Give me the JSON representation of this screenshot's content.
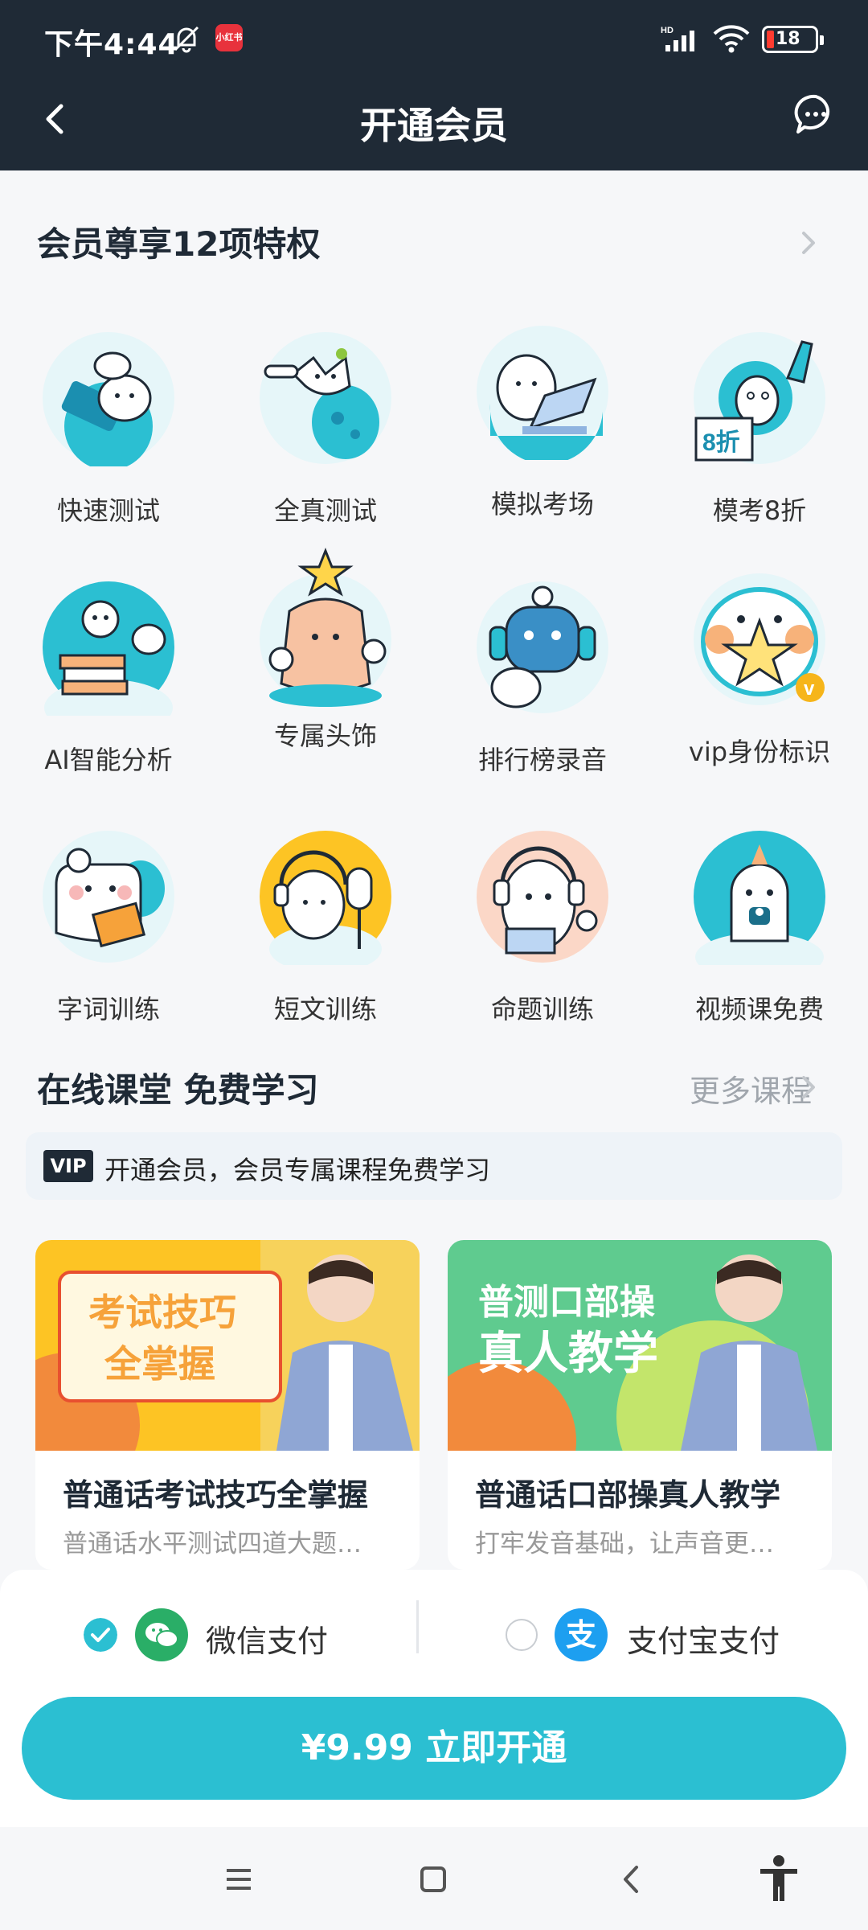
{
  "status_bar": {
    "time": "下午4:44",
    "app_badge": "小红书",
    "battery": "18",
    "icons": [
      "mute-icon",
      "hd-signal-icon",
      "wifi-icon",
      "battery-icon"
    ]
  },
  "header": {
    "title": "开通会员",
    "back_icon": "chevron-left-icon",
    "message_icon": "chat-bubble-icon"
  },
  "privileges": {
    "title": "会员尊享12项特权",
    "items": [
      {
        "label": "快速测试",
        "icon": "quick-test-icon"
      },
      {
        "label": "全真测试",
        "icon": "full-test-icon"
      },
      {
        "label": "模拟考场",
        "icon": "mock-exam-icon"
      },
      {
        "label": "模考8折",
        "icon": "discount-icon",
        "badge": "8折"
      },
      {
        "label": "AI智能分析",
        "icon": "ai-analysis-icon"
      },
      {
        "label": "专属头饰",
        "icon": "headwear-icon"
      },
      {
        "label": "排行榜录音",
        "icon": "ranking-recording-icon"
      },
      {
        "label": "vip身份标识",
        "icon": "vip-identity-icon"
      },
      {
        "label": "字词训练",
        "icon": "word-training-icon"
      },
      {
        "label": "短文训练",
        "icon": "essay-training-icon"
      },
      {
        "label": "命题训练",
        "icon": "topic-training-icon"
      },
      {
        "label": "视频课免费",
        "icon": "free-video-icon"
      }
    ]
  },
  "courses": {
    "title": "在线课堂 免费学习",
    "more": "更多课程",
    "banner_tag": "VIP",
    "banner_text": "开通会员，会员专属课程免费学习",
    "cards": [
      {
        "cover_text_1": "考试技巧",
        "cover_text_2": "全掌握",
        "title": "普通话考试技巧全掌握",
        "desc": "普通话水平测试四道大题…",
        "accent": "#fdc424"
      },
      {
        "cover_text_1": "普测口部操",
        "cover_text_2": "真人教学",
        "title": "普通话口部操真人教学",
        "desc": "打牢发音基础，让声音更…",
        "accent": "#3cc48e"
      }
    ]
  },
  "payment": {
    "wechat": "微信支付",
    "alipay": "支付宝支付",
    "alipay_glyph": "支",
    "selected": "wechat",
    "buy_label": "¥9.99 立即开通"
  },
  "colors": {
    "header_bg": "#1f2a36",
    "accent": "#2bbfd2",
    "wechat_green": "#2aae67",
    "alipay_blue": "#1d9ff0"
  },
  "nav_bar": {
    "icons": [
      "menu-icon",
      "home-square-icon",
      "back-triangle-icon",
      "accessibility-icon"
    ]
  }
}
